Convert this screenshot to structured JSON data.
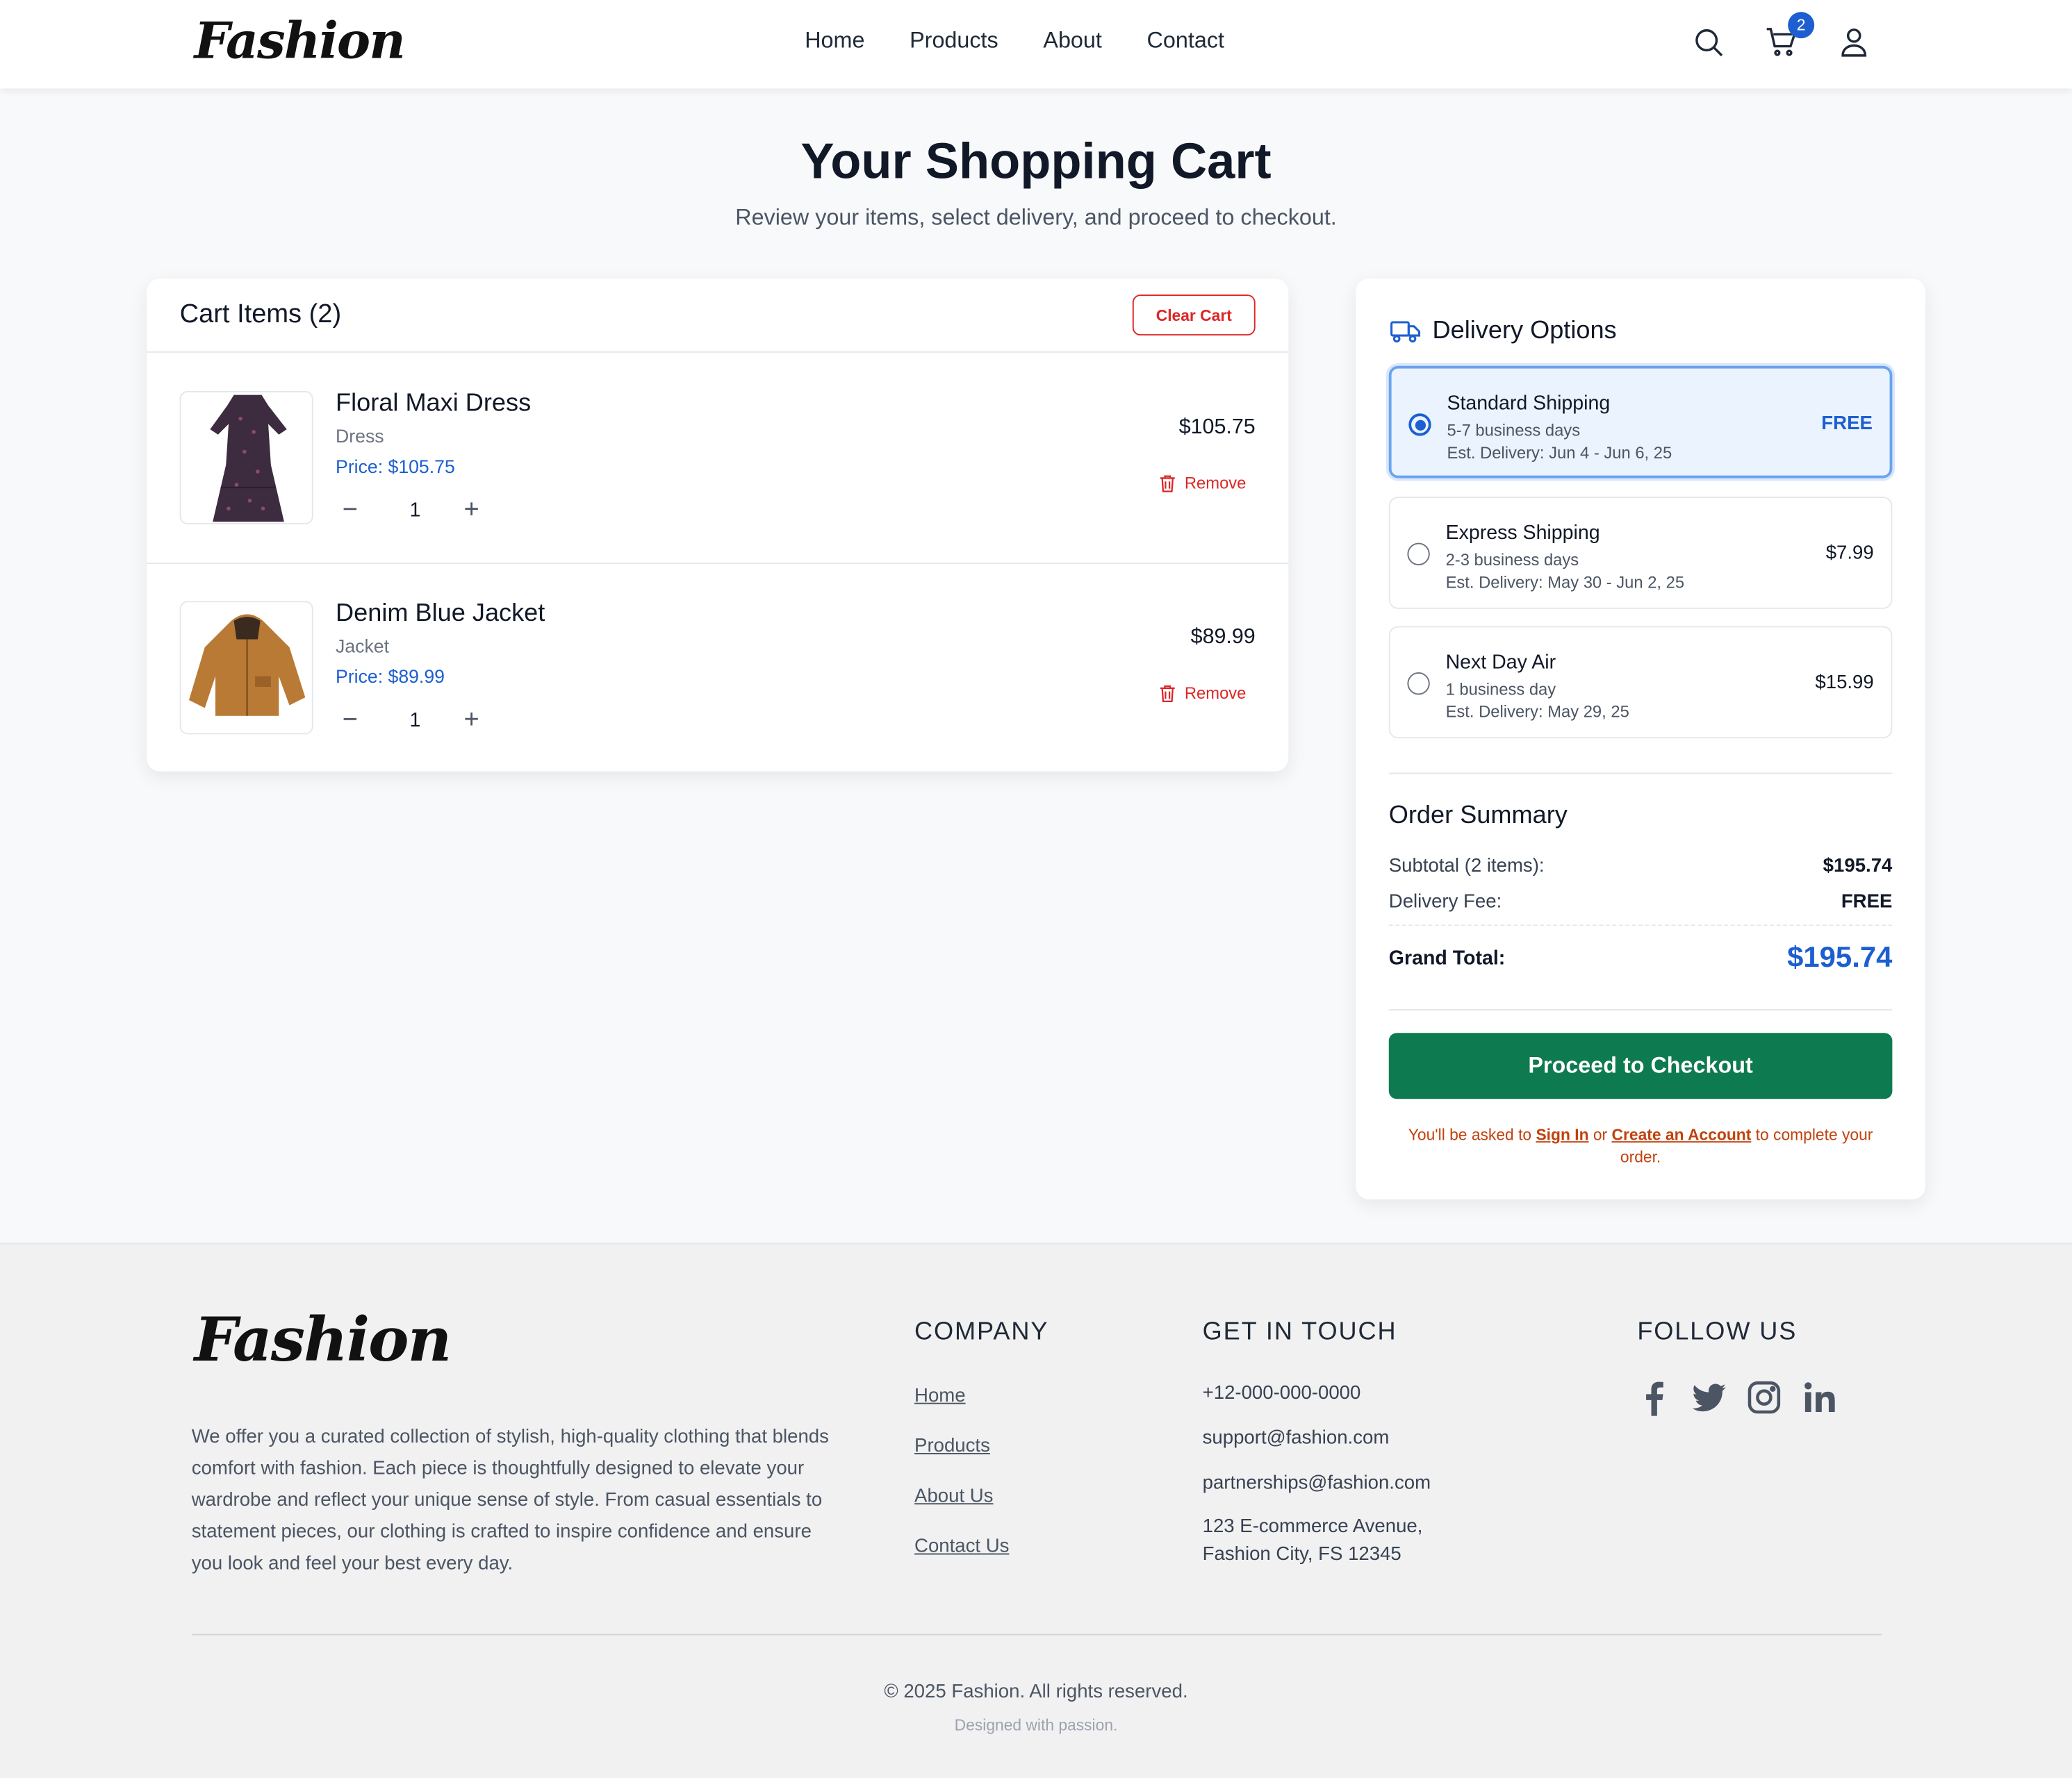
{
  "header": {
    "logo": "Fashion",
    "nav": [
      "Home",
      "Products",
      "About",
      "Contact"
    ],
    "cart_count": "2"
  },
  "page": {
    "title": "Your Shopping Cart",
    "subtitle": "Review your items, select delivery, and proceed to checkout."
  },
  "cart": {
    "heading": "Cart Items (2)",
    "clear_label": "Clear Cart",
    "remove_label": "Remove",
    "items": [
      {
        "name": "Floral Maxi Dress",
        "category": "Dress",
        "price_label": "Price: $105.75",
        "qty": "1",
        "line_total": "$105.75"
      },
      {
        "name": "Denim Blue Jacket",
        "category": "Jacket",
        "price_label": "Price: $89.99",
        "qty": "1",
        "line_total": "$89.99"
      }
    ]
  },
  "delivery": {
    "title": "Delivery Options",
    "options": [
      {
        "name": "Standard Shipping",
        "days": "5-7 business days",
        "est": "Est. Delivery: Jun 4 - Jun 6, 25",
        "price": "FREE",
        "selected": true
      },
      {
        "name": "Express Shipping",
        "days": "2-3 business days",
        "est": "Est. Delivery: May 30 - Jun 2, 25",
        "price": "$7.99",
        "selected": false
      },
      {
        "name": "Next Day Air",
        "days": "1 business day",
        "est": "Est. Delivery: May 29, 25",
        "price": "$15.99",
        "selected": false
      }
    ]
  },
  "summary": {
    "title": "Order Summary",
    "subtotal_label": "Subtotal (2 items):",
    "subtotal": "$195.74",
    "delivery_label": "Delivery Fee:",
    "delivery_fee": "FREE",
    "grand_label": "Grand Total:",
    "grand_total": "$195.74",
    "checkout_label": "Proceed to Checkout",
    "note_pre": "You'll be asked to ",
    "sign_in": "Sign In",
    "note_mid": " or ",
    "create_account": "Create an Account",
    "note_post": " to complete your order."
  },
  "footer": {
    "logo": "Fashion",
    "about": "We offer you a curated collection of stylish, high-quality clothing that blends comfort with fashion. Each piece is thoughtfully designed to elevate your wardrobe and reflect your unique sense of style. From casual essentials to statement pieces, our clothing is crafted to inspire confidence and ensure you look and feel your best every day.",
    "company_heading": "COMPANY",
    "company_links": [
      "Home",
      "Products",
      "About Us",
      "Contact Us"
    ],
    "contact_heading": "GET IN TOUCH",
    "phone": "+12-000-000-0000",
    "support_email": "support@fashion.com",
    "partner_email": "partnerships@fashion.com",
    "address_line1": "123 E-commerce Avenue,",
    "address_line2": "Fashion City, FS 12345",
    "follow_heading": "FOLLOW US",
    "social": [
      "facebook-icon",
      "twitter-icon",
      "instagram-icon",
      "linkedin-icon"
    ],
    "copyright": "© 2025 Fashion. All rights reserved.",
    "tagline": "Designed with passion."
  },
  "colors": {
    "accent": "#1d5fd1",
    "checkout": "#0d7a4f",
    "danger": "#dc2626",
    "note": "#c2410c"
  }
}
